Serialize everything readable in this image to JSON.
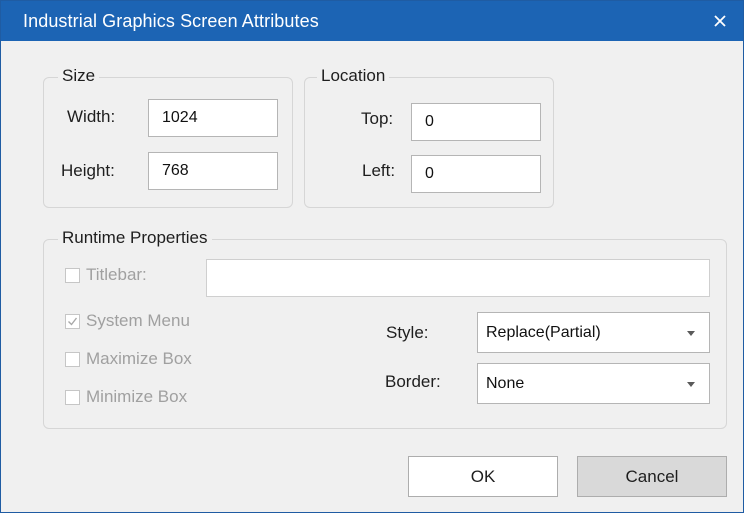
{
  "window": {
    "title": "Industrial Graphics Screen Attributes",
    "close_glyph": "close-icon"
  },
  "size": {
    "legend": "Size",
    "width_label": "Width:",
    "width_value": "1024",
    "height_label": "Height:",
    "height_value": "768"
  },
  "location": {
    "legend": "Location",
    "top_label": "Top:",
    "top_value": "0",
    "left_label": "Left:",
    "left_value": "0"
  },
  "runtime": {
    "legend": "Runtime Properties",
    "titlebar_label": "Titlebar:",
    "titlebar_checked": false,
    "titlebar_value": "",
    "system_menu_label": "System Menu",
    "system_menu_checked": true,
    "maximize_box_label": "Maximize Box",
    "maximize_box_checked": false,
    "minimize_box_label": "Minimize Box",
    "minimize_box_checked": false,
    "style_label": "Style:",
    "style_value": "Replace(Partial)",
    "border_label": "Border:",
    "border_value": "None"
  },
  "buttons": {
    "ok_label": "OK",
    "cancel_label": "Cancel"
  },
  "colors": {
    "titlebar": "#1c64b4",
    "dialog_bg": "#f0f0f0",
    "disabled_text": "#a0a0a0"
  }
}
